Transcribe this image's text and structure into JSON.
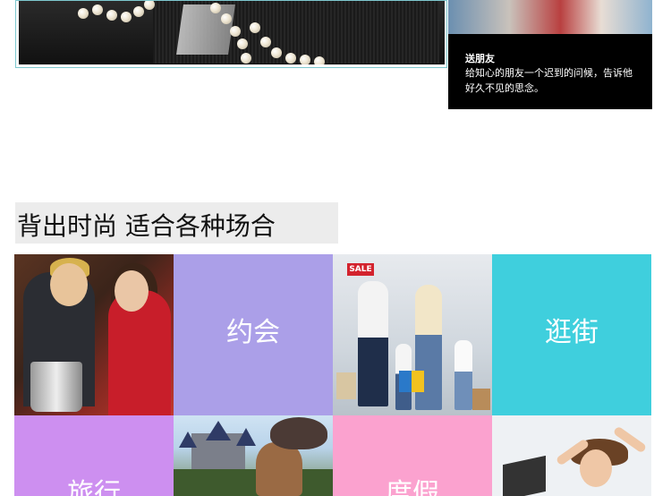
{
  "gift_card": {
    "title": "送朋友",
    "text": "给知心的朋友一个迟到的问候，告诉他好久不见的思念。"
  },
  "section": {
    "heading": "背出时尚 适合各种场合"
  },
  "tiles": [
    {
      "label": "约会",
      "color": "#ab9fe8"
    },
    {
      "label": "逛街",
      "color": "#3fcfdd"
    },
    {
      "label": "旅行",
      "color": "#cd8ff0"
    },
    {
      "label": "度假",
      "color": "#fba2cf"
    }
  ],
  "shop_image": {
    "sign": "SALE"
  },
  "colors": {
    "frame_border": "#7ec8cf",
    "heading_bg": "#ececec",
    "card_bg": "#000000"
  }
}
